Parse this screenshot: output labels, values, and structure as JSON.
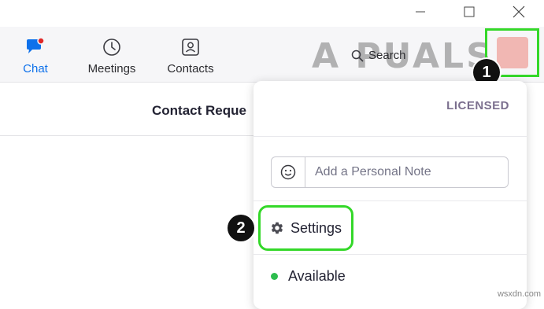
{
  "nav": {
    "tabs": [
      {
        "label": "Chat",
        "icon": "chat-icon",
        "active": true
      },
      {
        "label": "Meetings",
        "icon": "clock-icon"
      },
      {
        "label": "Contacts",
        "icon": "contacts-icon"
      }
    ],
    "search_label": "Search"
  },
  "watermark": "A  PUALS",
  "main": {
    "title": "Contact Reque"
  },
  "menu": {
    "license": "LICENSED",
    "note_placeholder": "Add a Personal Note",
    "settings_label": "Settings",
    "status_label": "Available"
  },
  "badges": {
    "one": "1",
    "two": "2"
  },
  "credit": "wsxdn.com",
  "colors": {
    "accent": "#0e71eb",
    "highlight": "#34d829",
    "status": "#2dbd4e",
    "notification": "#e02828"
  }
}
